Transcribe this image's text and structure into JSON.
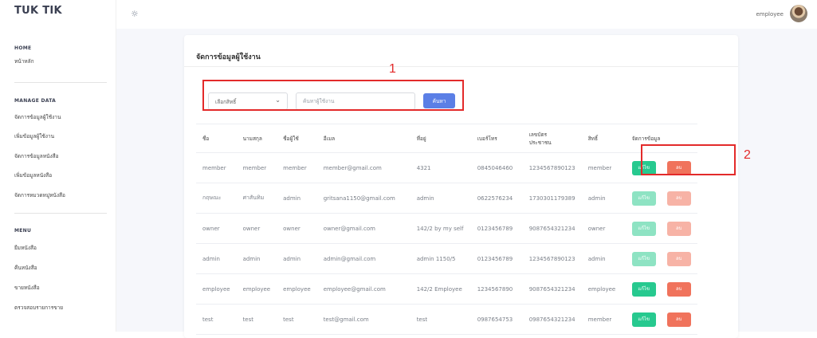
{
  "sidebar": {
    "brand": "TUK TIK",
    "sections": [
      {
        "title": "HOME",
        "items": [
          "หน้าหลัก"
        ]
      },
      {
        "title": "MANAGE DATA",
        "items": [
          "จัดการข้อมูลผู้ใช้งาน",
          "เพิ่มข้อมูลผู้ใช้งาน",
          "จัดการข้อมูลหนังสือ",
          "เพิ่มข้อมูลหนังสือ",
          "จัดการหมวดหมู่หนังสือ"
        ]
      },
      {
        "title": "MENU",
        "items": [
          "ยืมหนังสือ",
          "คืนหนังสือ",
          "ขายหนังสือ",
          "ตรวจสอบรายการขาย"
        ]
      }
    ]
  },
  "header": {
    "user_label": "employee",
    "theme_icon": "sun-icon"
  },
  "page": {
    "title": "จัดการข้อมูลผู้ใช้งาน",
    "filter": {
      "role_select_value": "เลือกสิทธิ์",
      "search_placeholder": "ค้นหาผู้ใช้งาน",
      "search_button": "ค้นหา"
    },
    "table": {
      "headers": [
        "ชื่อ",
        "นามสกุล",
        "ชื่อผู้ใช้",
        "อีเมล",
        "ที่อยู่",
        "เบอร์โทร",
        "เลขบัตร\nประชาชน",
        "สิทธิ์",
        "จัดการข้อมูล"
      ],
      "edit_label": "แก้ไข",
      "delete_label": "ลบ",
      "rows": [
        [
          "member",
          "member",
          "member",
          "member@gmail.com",
          "4321",
          "0845046460",
          "1234567890123",
          "member"
        ],
        [
          "กฤษณะ",
          "ศาสันทิม",
          "admin",
          "gritsana1150@gmail.com",
          "admin",
          "0622576234",
          "1730301179389",
          "admin"
        ],
        [
          "owner",
          "owner",
          "owner",
          "owner@gmail.com",
          "142/2 by my self",
          "0123456789",
          "9087654321234",
          "owner"
        ],
        [
          "admin",
          "admin",
          "admin",
          "admin@gmail.com",
          "admin 1150/5",
          "0123456789",
          "1234567890123",
          "admin"
        ],
        [
          "employee",
          "employee",
          "employee",
          "employee@gmail.com",
          "142/2 Employee",
          "1234567890",
          "9087654321234",
          "employee"
        ],
        [
          "test",
          "test",
          "test",
          "test@gmail.com",
          "test",
          "0987654753",
          "0987654321234",
          "member"
        ]
      ]
    }
  },
  "annotations": [
    "1",
    "2"
  ],
  "colors": {
    "accent_blue": "#5b7fe6",
    "edit_green": "#27c98f",
    "delete_red": "#f0735c",
    "annotation_red": "#e32a2a"
  }
}
